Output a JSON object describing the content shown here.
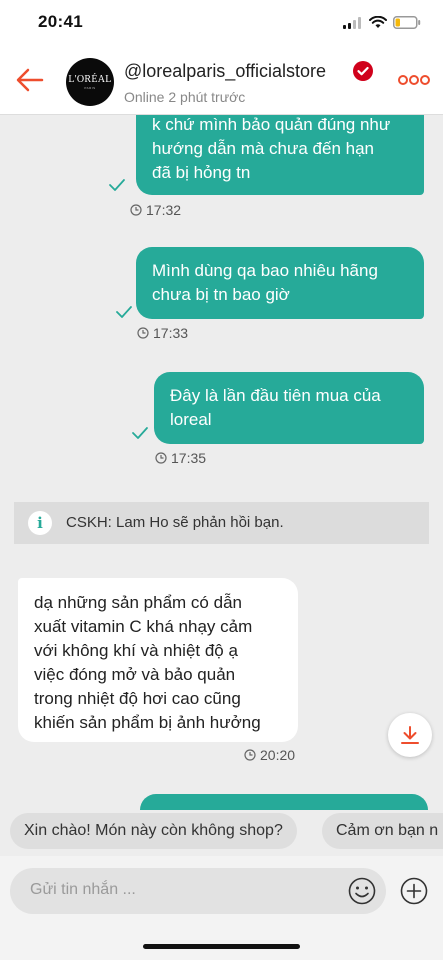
{
  "status_bar": {
    "time": "20:41"
  },
  "header": {
    "shop_name": "@lorealparis_officialstore",
    "status": "Online 2 phút trước",
    "avatar_text": "L'ORÉAL",
    "avatar_sub": "PARIS"
  },
  "messages": [
    {
      "side": "out",
      "lines": [
        "k chứ mình bảo quản đúng như",
        "hướng dẫn mà chưa đến hạn",
        "đã bị hỏng tn"
      ],
      "time": "17:32"
    },
    {
      "side": "out",
      "lines": [
        "Mình dùng qa bao nhiêu hãng",
        "chưa bị tn bao giờ"
      ],
      "time": "17:33"
    },
    {
      "side": "out",
      "lines": [
        "Đây là lần đầu tiên mua của",
        "loreal"
      ],
      "time": "17:35"
    },
    {
      "side": "in",
      "lines": [
        "dạ những sản phẩm có dẫn",
        "xuất vitamin C khá nhạy cảm",
        "với không khí và nhiệt độ ạ",
        "việc đóng mở và bảo quản",
        "trong nhiệt độ hơi cao cũng",
        "khiến sản phẩm bị ảnh hưởng"
      ],
      "time": "20:20"
    }
  ],
  "notice": {
    "icon": "i",
    "text": "CSKH: Lam Ho sẽ phản hồi bạn."
  },
  "quick_replies": [
    "Xin chào! Món này còn không shop?",
    "Cảm ơn bạn n"
  ],
  "input": {
    "placeholder": "Gửi tin nhắn ..."
  },
  "colors": {
    "accent": "#ee4d2d",
    "bubble_out": "#26aa99",
    "verified": "#d0011b"
  }
}
